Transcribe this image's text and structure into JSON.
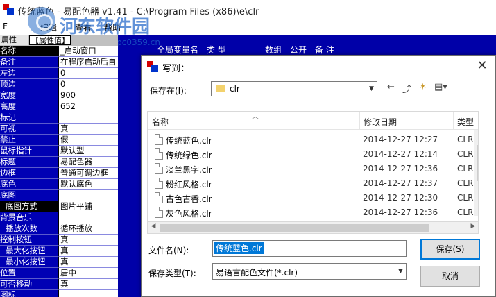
{
  "app": {
    "title": "传统蓝色 - 易配色器 v1.41 - C:\\Program Files (x86)\\e\\clr",
    "menu": [
      "F",
      "编辑",
      "查看",
      "帮助"
    ]
  },
  "watermark": {
    "text": "河东软件园",
    "url": "www.pc0359.cn"
  },
  "properties": {
    "tabs": [
      "属性",
      "【属性值】"
    ],
    "rows": [
      {
        "k": "名称",
        "v": "_启动窗口",
        "hl": true
      },
      {
        "k": "备注",
        "v": "在程序启动后自"
      },
      {
        "k": "左边",
        "v": "0"
      },
      {
        "k": "顶边",
        "v": "0"
      },
      {
        "k": "宽度",
        "v": "900"
      },
      {
        "k": "高度",
        "v": "652"
      },
      {
        "k": "标记",
        "v": ""
      },
      {
        "k": "可视",
        "v": "真"
      },
      {
        "k": "禁止",
        "v": "假"
      },
      {
        "k": "鼠标指针",
        "v": "默认型"
      },
      {
        "k": "标题",
        "v": "易配色器"
      },
      {
        "k": "边框",
        "v": "普通可调边框"
      },
      {
        "k": "底色",
        "v": "默认底色"
      },
      {
        "k": "底图",
        "v": ""
      },
      {
        "k": "底图方式",
        "v": "图片平铺",
        "hl": true,
        "indent": true
      },
      {
        "k": "背景音乐",
        "v": ""
      },
      {
        "k": "播放次数",
        "v": "循环播放",
        "indent": true
      },
      {
        "k": "控制按钮",
        "v": "真"
      },
      {
        "k": "最大化按钮",
        "v": "真",
        "indent": true
      },
      {
        "k": "最小化按钮",
        "v": "真",
        "indent": true
      },
      {
        "k": "位置",
        "v": "居中"
      },
      {
        "k": "可否移动",
        "v": "真"
      },
      {
        "k": "图标",
        "v": ""
      }
    ]
  },
  "bg_table": {
    "headers": [
      "全局变量名",
      "类 型",
      "数组",
      "公开",
      "备 注"
    ]
  },
  "dialog": {
    "title": "写到：",
    "close_label": "✕",
    "save_in_label": "保存在(I):",
    "save_in_value": "clr",
    "toolbar": {
      "back": "←",
      "up": "⤴",
      "new_folder": "✶",
      "view": "▤▾"
    },
    "columns": [
      "名称",
      "修改日期",
      "类型"
    ],
    "files": [
      {
        "name": "传统蓝色.clr",
        "date": "2014-12-27 12:27",
        "type": "CLR"
      },
      {
        "name": "传统绿色.clr",
        "date": "2014-12-27 12:14",
        "type": "CLR"
      },
      {
        "name": "淡兰黑字.clr",
        "date": "2014-12-27 12:36",
        "type": "CLR"
      },
      {
        "name": "粉红风格.clr",
        "date": "2014-12-27 12:37",
        "type": "CLR"
      },
      {
        "name": "古色古香.clr",
        "date": "2014-12-27 12:30",
        "type": "CLR"
      },
      {
        "name": "灰色风格.clr",
        "date": "2014-12-27 12:36",
        "type": "CLR"
      }
    ],
    "filename_label": "文件名(N):",
    "filename_value": "传统蓝色.clr",
    "filetype_label": "保存类型(T):",
    "filetype_value": "易语言配色文件(*.clr)",
    "save_button": "保存(S)",
    "cancel_button": "取消"
  }
}
